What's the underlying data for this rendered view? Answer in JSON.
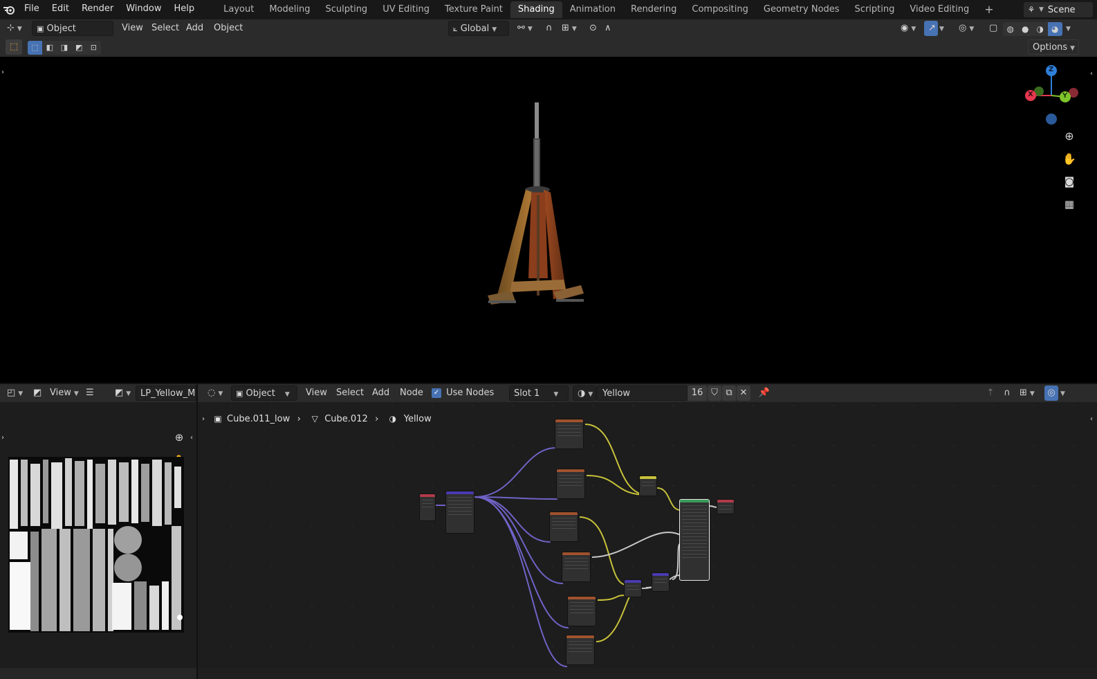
{
  "menubar": {
    "items": [
      "File",
      "Edit",
      "Render",
      "Window",
      "Help"
    ],
    "workspaces": [
      "Layout",
      "Modeling",
      "Sculpting",
      "UV Editing",
      "Texture Paint",
      "Shading",
      "Animation",
      "Rendering",
      "Compositing",
      "Geometry Nodes",
      "Scripting",
      "Video Editing"
    ],
    "active_workspace": "Shading",
    "add_tab": "+",
    "scene": "Scene"
  },
  "viewport_header": {
    "mode": "Object Mode",
    "menus": [
      "View",
      "Select",
      "Add",
      "Object"
    ],
    "orientation": "Global",
    "options": "Options"
  },
  "gizmo": {
    "z": "Z",
    "x": "X",
    "y": "Y"
  },
  "image_editor": {
    "view": "View",
    "image_name": "LP_Yellow_Meta"
  },
  "node_editor": {
    "object_type": "Object",
    "menus": [
      "View",
      "Select",
      "Add",
      "Node"
    ],
    "use_nodes": "Use Nodes",
    "slot": "Slot 1",
    "material": "Yellow",
    "users": "16",
    "breadcrumb": {
      "object": "Cube.011_low",
      "mesh": "Cube.012",
      "material": "Yellow"
    }
  },
  "colors": {
    "accent": "#4772b3",
    "wire_purple": "#6f63c7",
    "wire_yellow": "#c7c23a",
    "wire_gray": "#c9c9c9",
    "axis_x": "#e5374e",
    "axis_y": "#80c42b",
    "axis_z": "#2f80d9"
  }
}
